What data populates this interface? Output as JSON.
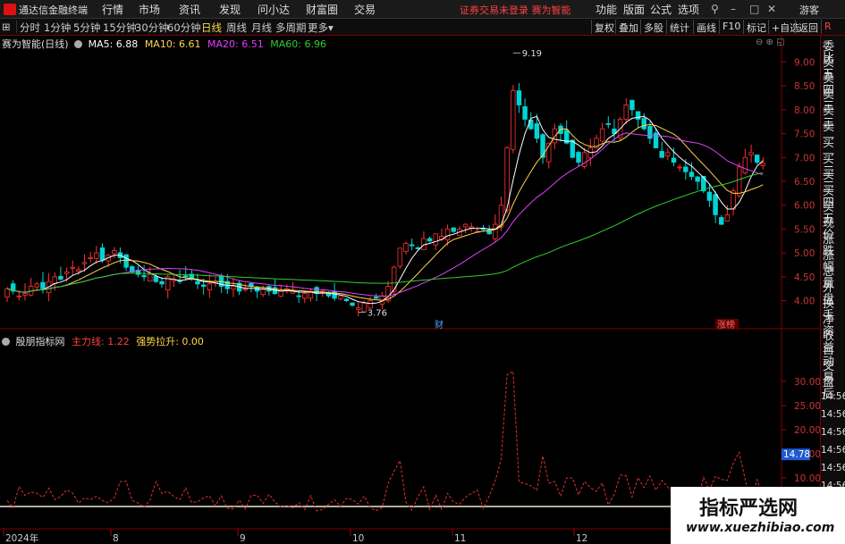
{
  "app": {
    "title": "通达信金融终端",
    "menus": [
      "行情",
      "市场",
      "资讯",
      "发现",
      "问小达",
      "财富圈",
      "交易"
    ],
    "login_warning": "证券交易未登录",
    "login_product": "赛为智能",
    "right_menus": [
      "功能",
      "版面",
      "公式",
      "选项"
    ],
    "guest": "游客"
  },
  "toolbar": {
    "periods": [
      "分时",
      "1分钟",
      "5分钟",
      "15分钟",
      "30分钟",
      "60分钟",
      "日线",
      "周线",
      "月线",
      "多周期",
      "更多"
    ],
    "active_period": "日线",
    "buttons": [
      "复权",
      "叠加",
      "多股",
      "统计",
      "画线",
      "F10",
      "标记",
      "+自选",
      "返回"
    ]
  },
  "sidepanel": {
    "items": [
      "委比",
      "卖五",
      "卖四",
      "卖三",
      "卖二",
      "卖一",
      "买一",
      "买二",
      "买三",
      "买四",
      "买五",
      "现价",
      "涨跌",
      "涨幅",
      "总量",
      "外盘",
      "换手",
      "净资",
      "收益",
      "自动",
      "交易",
      "盘后"
    ],
    "times": [
      "14:56",
      "14:56",
      "14:56",
      "14:56",
      "14:56",
      "14:56",
      "14:56",
      "14:56"
    ]
  },
  "kline_panel": {
    "stock_name": "赛为智能(日线)",
    "ma": [
      {
        "label": "MA5: 6.88",
        "color": "#ffffff"
      },
      {
        "label": "MA10: 6.61",
        "color": "#ffd54a"
      },
      {
        "label": "MA20: 6.51",
        "color": "#e040fb"
      },
      {
        "label": "MA60: 6.96",
        "color": "#33cc33"
      }
    ],
    "y_ticks": [
      "9.00",
      "8.50",
      "8.00",
      "7.50",
      "7.00",
      "6.50",
      "6.00",
      "5.50",
      "5.00",
      "4.50",
      "4.00"
    ],
    "high_label": "9.19",
    "low_label": "3.76",
    "event_tags": [
      "财",
      "涨榜"
    ],
    "current_price_marker": "R"
  },
  "indicator_panel": {
    "name": "殷朋指标网",
    "line1": "主力线: 1.22",
    "line2": "强势拉升: 0.00",
    "y_ticks": [
      "30.00",
      "25.00",
      "20.00",
      "15.00",
      "10.00",
      "5.00"
    ],
    "current_value": "14.78"
  },
  "x_axis": [
    "2024年",
    "8",
    "9",
    "10",
    "11",
    "12"
  ],
  "watermark": {
    "title": "指标严选网",
    "url": "www.xuezhibiao.com"
  },
  "chart_data": {
    "type": "candlestick",
    "title": "赛为智能(日线)",
    "x_ticks": [
      "2024年",
      "8",
      "9",
      "10",
      "11",
      "12"
    ],
    "ylim": [
      3.6,
      9.4
    ],
    "closes": [
      4.25,
      4.2,
      4.1,
      4.15,
      4.3,
      4.35,
      4.25,
      4.4,
      4.5,
      4.45,
      4.6,
      4.7,
      4.65,
      4.8,
      4.9,
      5.0,
      4.85,
      4.95,
      5.05,
      4.9,
      4.7,
      4.6,
      4.55,
      4.5,
      4.55,
      4.4,
      4.35,
      4.5,
      4.45,
      4.4,
      4.5,
      4.45,
      4.35,
      4.3,
      4.35,
      4.4,
      4.3,
      4.25,
      4.3,
      4.2,
      4.25,
      4.3,
      4.2,
      4.25,
      4.2,
      4.15,
      4.2,
      4.25,
      4.2,
      4.1,
      4.15,
      4.2,
      4.15,
      4.2,
      4.1,
      4.05,
      4.1,
      4.0,
      3.9,
      3.85,
      3.95,
      4.0,
      4.05,
      4.1,
      4.3,
      4.7,
      5.1,
      5.2,
      5.15,
      5.1,
      5.3,
      5.25,
      5.4,
      5.35,
      5.5,
      5.45,
      5.5,
      5.6,
      5.55,
      5.45,
      5.5,
      5.4,
      5.6,
      6.0,
      7.2,
      8.4,
      8.1,
      7.8,
      7.6,
      7.4,
      7.0,
      7.3,
      7.6,
      7.5,
      7.3,
      7.0,
      6.9,
      7.1,
      7.2,
      7.4,
      7.6,
      7.7,
      7.5,
      7.8,
      8.1,
      8.0,
      7.8,
      7.6,
      7.4,
      7.2,
      7.0,
      7.1,
      6.9,
      6.8,
      6.7,
      6.6,
      6.5,
      6.3,
      6.1,
      5.8,
      5.6,
      5.8,
      6.3,
      6.8,
      7.0,
      7.1,
      6.9,
      6.88
    ],
    "ma5": 6.88,
    "ma10": 6.61,
    "ma20": 6.51,
    "ma60": 6.96
  }
}
